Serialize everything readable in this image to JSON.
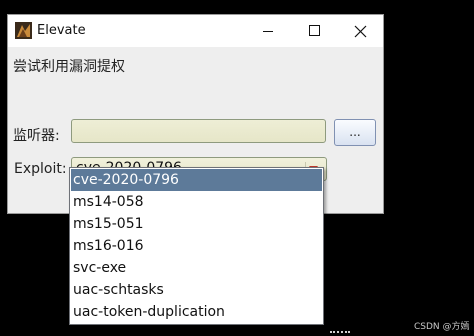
{
  "window": {
    "title": "Elevate",
    "icon": "app-icon"
  },
  "client": {
    "heading": "尝试利用漏洞提权",
    "monitor_label": "监听器:",
    "monitor_value": "",
    "browse_label": "...",
    "exploit_label": "Exploit:",
    "exploit_selected": "cve-2020-0796"
  },
  "dropdown": {
    "options": [
      "cve-2020-0796",
      "ms14-058",
      "ms15-051",
      "ms16-016",
      "svc-exe",
      "uac-schtasks",
      "uac-token-duplication"
    ],
    "highlighted_index": 0
  },
  "colors": {
    "highlight": "#5d7a99",
    "field_bg": "#e6e6c8",
    "arrow": "#c0392b"
  },
  "watermark": "CSDN @方嫣"
}
